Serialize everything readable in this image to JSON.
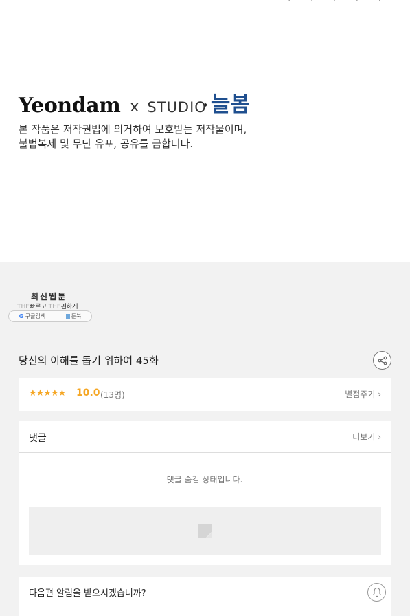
{
  "top_status": "· · · · ·",
  "brand": {
    "yeondam": "Yeondam",
    "x": "x",
    "studio": "STUDIO",
    "neulbom": "늘봄"
  },
  "notice": {
    "line1": "본 작품은 저작권법에 의거하여 보호받는 저작물이며,",
    "line2": "불법복제 및 무단 유포, 공유를 금합니다."
  },
  "ad": {
    "title": "최신웹툰",
    "the1": "THE",
    "phrase1": "빠르고",
    "the2": "THE",
    "phrase2": "편하게",
    "google": "G",
    "search_label": "구글검색",
    "site_label": "툰북"
  },
  "episode": {
    "title": "당신의 이해를 돕기 위하여 45화"
  },
  "rating": {
    "stars": "★★★★★",
    "score": "10.0",
    "count": "(13명)",
    "rate_label": "별점주기 ›"
  },
  "comments": {
    "label": "댓글",
    "more_label": "더보기 ›",
    "hidden_message": "댓글 숨김 상태입니다."
  },
  "notify": {
    "question": "다음편 알림을 받으시겠습니까?"
  },
  "colors": {
    "accent_star": "#f5a623",
    "brand_blue": "#1f4f8f",
    "page_bg": "#f2f2f2"
  }
}
